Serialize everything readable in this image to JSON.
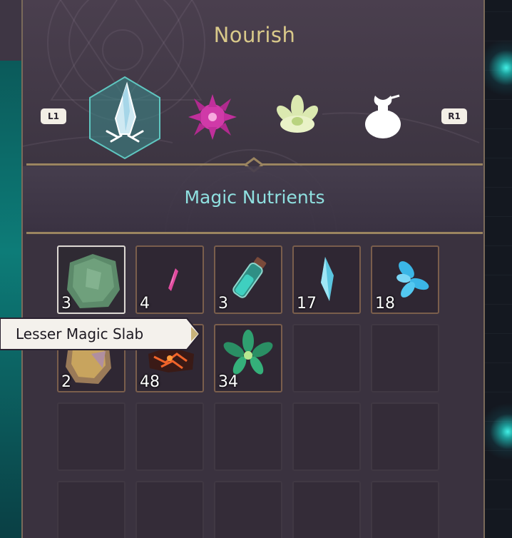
{
  "header": {
    "title": "Nourish"
  },
  "nav": {
    "prev_button": "L1",
    "next_button": "R1"
  },
  "tabs": [
    {
      "icon": "crystal-icon",
      "selected": true
    },
    {
      "icon": "magenta-flower-icon",
      "selected": false
    },
    {
      "icon": "leaf-bloom-icon",
      "selected": false
    },
    {
      "icon": "sack-icon",
      "selected": false
    }
  ],
  "section": {
    "title": "Magic Nutrients"
  },
  "items": [
    {
      "icon": "green-stone-slab-icon",
      "count": "3",
      "selected": true
    },
    {
      "icon": "pink-shard-icon",
      "count": "4"
    },
    {
      "icon": "teal-potion-icon",
      "count": "3"
    },
    {
      "icon": "blue-crystal-icon",
      "count": "17"
    },
    {
      "icon": "blue-petals-icon",
      "count": "18"
    },
    {
      "icon": "gold-stone-icon",
      "count": "2"
    },
    {
      "icon": "lava-rock-icon",
      "count": "48"
    },
    {
      "icon": "green-leaf-icon",
      "count": "34"
    }
  ],
  "tooltip": {
    "text": "Lesser Magic Slab"
  },
  "colors": {
    "title": "#d9c98a",
    "section_title": "#8fe0e0",
    "accent_teal": "#43f0e6",
    "frame_gold": "#9b8560"
  }
}
